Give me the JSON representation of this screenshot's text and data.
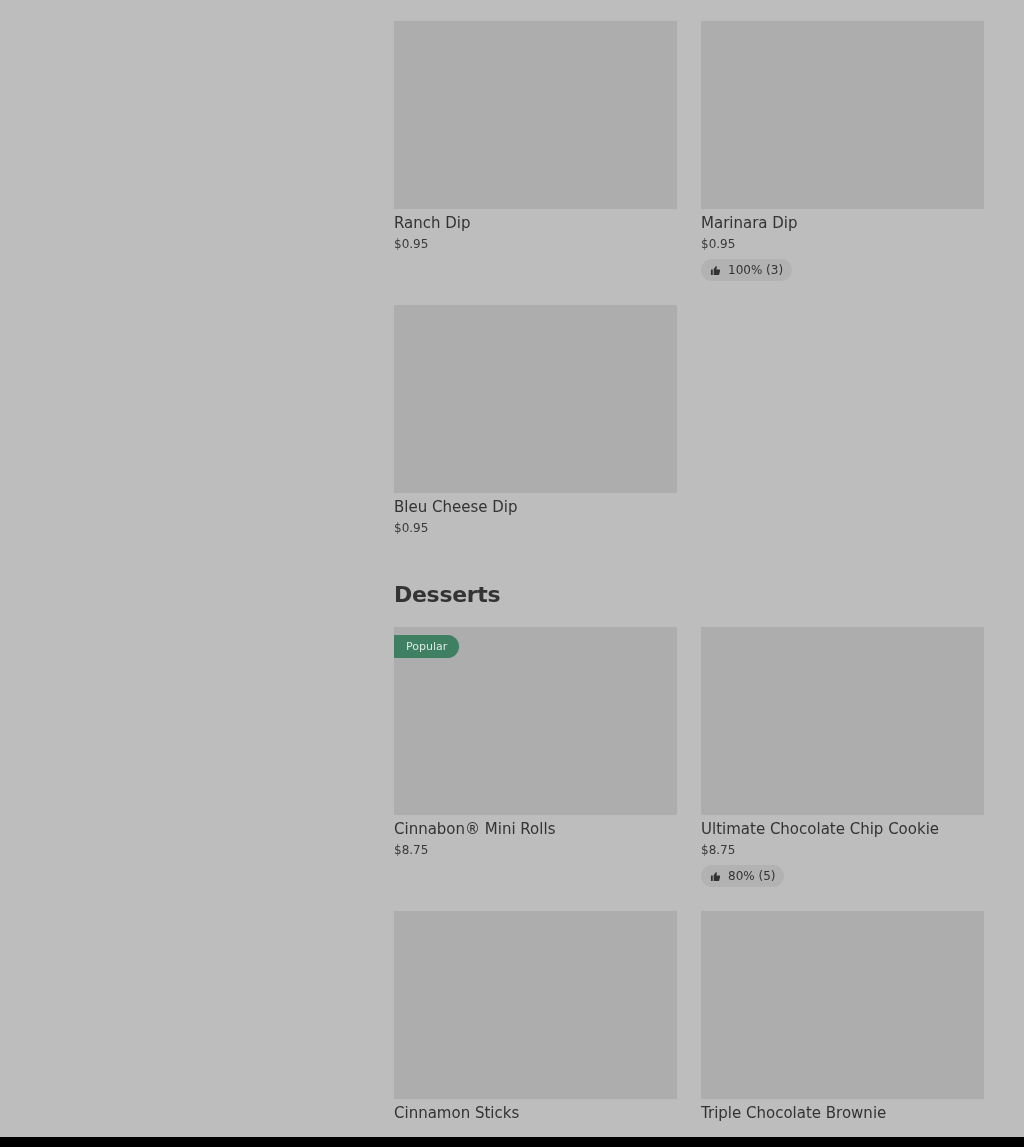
{
  "sections": [
    {
      "items": [
        {
          "name": "Ranch Dip",
          "price": "$0.95"
        },
        {
          "name": "Marinara Dip",
          "price": "$0.95",
          "rating": "100% (3)"
        },
        {
          "name": "Bleu Cheese Dip",
          "price": "$0.95"
        }
      ]
    },
    {
      "title": "Desserts",
      "items": [
        {
          "name": "Cinnabon® Mini Rolls",
          "price": "$8.75",
          "badge": "Popular"
        },
        {
          "name": "Ultimate Chocolate Chip Cookie",
          "price": "$8.75",
          "rating": "80% (5)"
        },
        {
          "name": "Cinnamon Sticks"
        },
        {
          "name": "Triple Chocolate Brownie"
        }
      ]
    }
  ]
}
